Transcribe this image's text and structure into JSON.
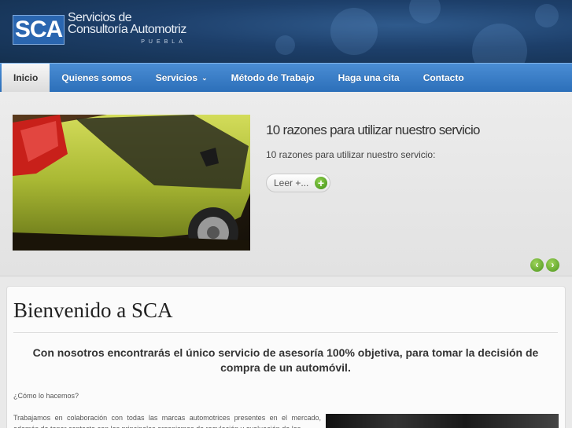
{
  "header": {
    "logo_mark": "SCA",
    "logo_line1": "Servicios de",
    "logo_line2": "Consultoría Automotriz",
    "logo_line3": "PUEBLA"
  },
  "nav": {
    "items": [
      {
        "label": "Inicio",
        "active": true
      },
      {
        "label": "Quienes somos"
      },
      {
        "label": "Servicios",
        "has_dropdown": true
      },
      {
        "label": "Método de Trabajo"
      },
      {
        "label": "Haga una cita"
      },
      {
        "label": "Contacto"
      }
    ]
  },
  "slider": {
    "title": "10 razones para utilizar nuestro servicio",
    "text": "10 razones para utilizar nuestro servicio:",
    "read_more": "Leer +...",
    "prev_icon": "chevron-left-icon",
    "next_icon": "chevron-right-icon"
  },
  "content": {
    "title": "Bienvenido a SCA",
    "lead": "Con nosotros encontrarás el único servicio de asesoría 100% objetiva, para tomar la decisión de compra de un automóvil.",
    "question": "¿Cómo lo hacemos?",
    "body": "Trabajamos en colaboración con todas las marcas automotrices presentes en el mercado, además de tener contacto con los principales organismos de regulación y evaluación de los"
  },
  "colors": {
    "header_bg": "#1d3f6a",
    "nav_bg": "#2c6fb9",
    "accent_green": "#4c951c",
    "car_color": "#b6c23a"
  }
}
